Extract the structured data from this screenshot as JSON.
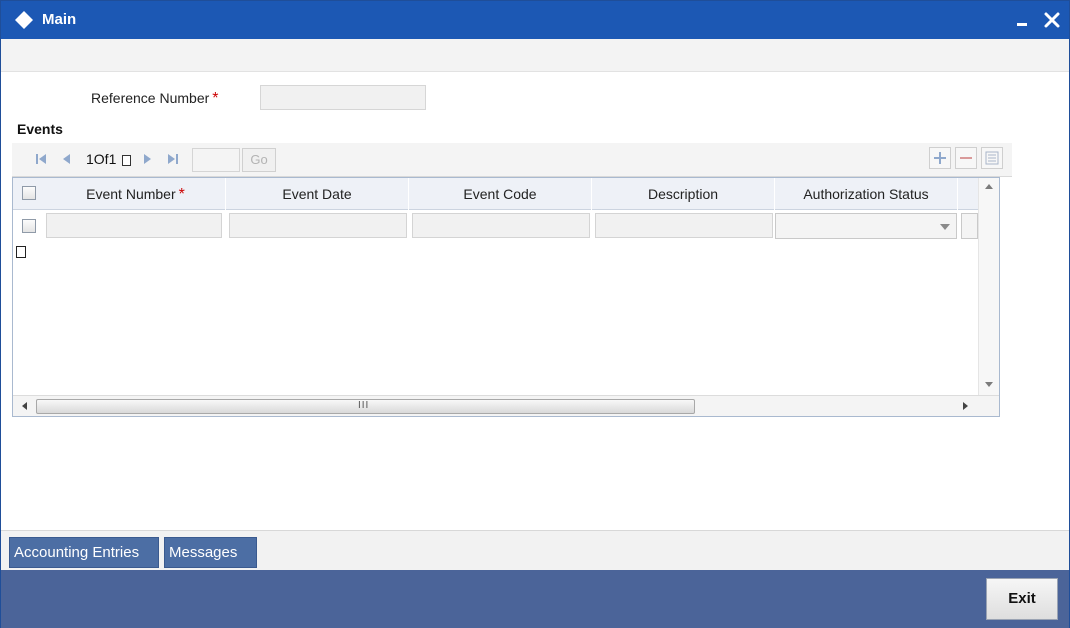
{
  "window": {
    "title": "Main"
  },
  "form": {
    "reference_number_label": "Reference Number",
    "reference_number_value": "",
    "required_marker": "*"
  },
  "events": {
    "section_label": "Events",
    "pager": {
      "text": "1Of1",
      "page_value": "",
      "go_label": "Go"
    },
    "columns": [
      {
        "label": "Event Number",
        "required": true
      },
      {
        "label": "Event Date",
        "required": false
      },
      {
        "label": "Event Code",
        "required": false
      },
      {
        "label": "Description",
        "required": false
      },
      {
        "label": "Authorization Status",
        "required": false
      }
    ],
    "scroll_grip": "III"
  },
  "bottom_tabs": [
    "Accounting Entries",
    "Messages"
  ],
  "footer": {
    "exit_label": "Exit"
  },
  "colors": {
    "titlebar": "#1c58b4",
    "footer": "#4b6499",
    "tab": "#4c6ea4",
    "required": "#cc0000"
  },
  "icons": {
    "title": "diamond-icon",
    "minimize": "minimize-icon",
    "close": "close-icon",
    "first": "first-page-icon",
    "prev": "previous-page-icon",
    "next": "next-page-icon",
    "last": "last-page-icon",
    "add": "add-row-icon",
    "delete": "delete-row-icon",
    "view": "single-view-icon"
  }
}
